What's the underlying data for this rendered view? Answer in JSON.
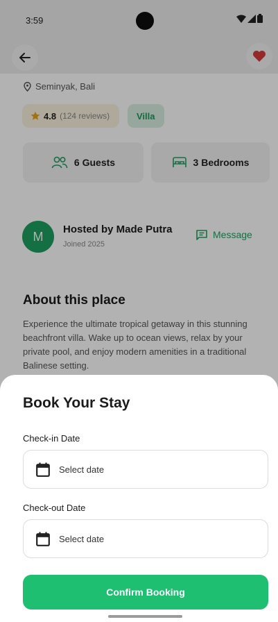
{
  "status_bar": {
    "time": "3:59"
  },
  "listing": {
    "location": "Seminyak, Bali",
    "rating": "4.8",
    "reviews": "(124 reviews)",
    "type": "Villa",
    "guests": "6 Guests",
    "bedrooms": "3 Bedrooms"
  },
  "host": {
    "initial": "M",
    "name": "Hosted by Made Putra",
    "joined": "Joined 2025",
    "message_label": "Message"
  },
  "about": {
    "title": "About this place",
    "text": "Experience the ultimate tropical getaway in this stunning beachfront villa. Wake up to ocean views, relax by your private pool, and enjoy modern amenities in a traditional Balinese setting."
  },
  "booking": {
    "title": "Book Your Stay",
    "checkin_label": "Check-in Date",
    "checkin_value": "Select date",
    "checkout_label": "Check-out Date",
    "checkout_value": "Select date",
    "confirm_label": "Confirm Booking"
  },
  "colors": {
    "accent": "#1fbf72",
    "accent_dark": "#1ea160",
    "favorite": "#d63b3b",
    "star": "#e8a317"
  },
  "icons": [
    "arrow-left-icon",
    "heart-icon",
    "location-pin-icon",
    "star-icon",
    "users-icon",
    "bed-icon",
    "chat-icon",
    "calendar-icon"
  ]
}
